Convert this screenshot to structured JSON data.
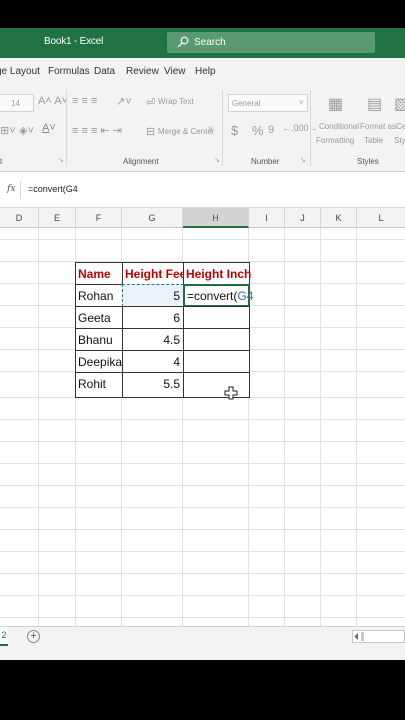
{
  "window": {
    "title": "Book1  -  Excel"
  },
  "search": {
    "label": "Search"
  },
  "menu": {
    "tabs": [
      "ge Layout",
      "Formulas",
      "Data",
      "Review",
      "View",
      "Help"
    ]
  },
  "ribbon": {
    "font_size": "14",
    "number_format": "General",
    "wrap_text": "Wrap Text",
    "merge_center": "Merge & Center",
    "currency_symbol": "$",
    "percent_symbol": "%",
    "comma_symbol": "9",
    "conditional_formatting": [
      "Conditional",
      "Formatting"
    ],
    "format_as_table": [
      "Format as",
      "Table"
    ],
    "cell_styles": [
      "Ce",
      "Style"
    ],
    "groups": {
      "font": "t",
      "alignment": "Alignment",
      "number": "Number",
      "styles": "Styles"
    }
  },
  "formula_bar": {
    "fx": "fx",
    "content": "=convert(G4"
  },
  "columns": [
    "D",
    "E",
    "F",
    "G",
    "H",
    "I",
    "J",
    "K",
    "L"
  ],
  "selected_column": "H",
  "table": {
    "headers": [
      "Name",
      "Height Feet",
      "Height Inch"
    ],
    "rows": [
      {
        "name": "Rohan",
        "feet": "5",
        "inch_prefix": "=convert(",
        "inch_ref": "G4"
      },
      {
        "name": "Geeta",
        "feet": "6",
        "inch_prefix": "",
        "inch_ref": ""
      },
      {
        "name": "Bhanu",
        "feet": "4.5",
        "inch_prefix": "",
        "inch_ref": ""
      },
      {
        "name": "Deepika",
        "feet": "4",
        "inch_prefix": "",
        "inch_ref": ""
      },
      {
        "name": "Rohit",
        "feet": "5.5",
        "inch_prefix": "",
        "inch_ref": ""
      }
    ]
  },
  "sheet_tabs": {
    "active": "2",
    "add": "+"
  },
  "colors": {
    "excel_green": "#217346",
    "header_red": "#c00000",
    "ref_blue": "#2f6fb0"
  }
}
